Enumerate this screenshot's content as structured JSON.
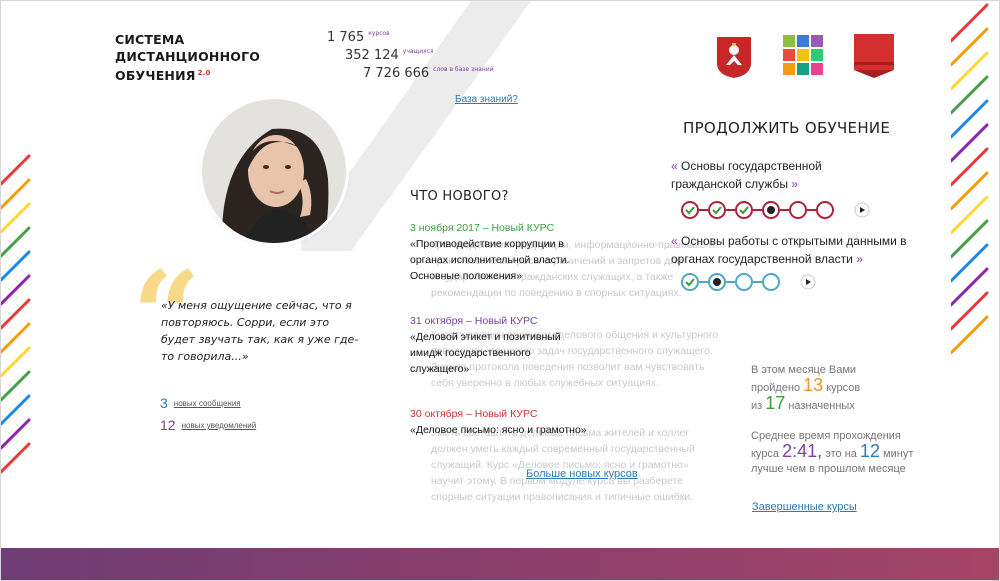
{
  "brand": {
    "line1": "СИСТЕМА",
    "line2": "ДИСТАНЦИОННОГО",
    "line3": "ОБУЧЕНИЯ",
    "version": "2.0"
  },
  "stats": [
    {
      "value": "1 765",
      "label": "курсов"
    },
    {
      "value": "352 124",
      "label": "учащихся"
    },
    {
      "value": "7 726 666",
      "label": "слов в базе знаний"
    }
  ],
  "knowledge_link": "База знаний?",
  "logos": [
    "moscow-coat-of-arms-icon",
    "mosaic-logo-icon",
    "red-banner-logo-icon"
  ],
  "quote": {
    "text": "«У меня ощущение сейчас, что я повторяюсь. Сорри, если это будет звучать так, как я уже где-то говорила...»"
  },
  "counters": [
    {
      "number": "3",
      "label": "новых сообщения",
      "color": "#2a7ab8"
    },
    {
      "number": "12",
      "label": "новых уведомлений",
      "color": "#7a3fa0"
    }
  ],
  "news": {
    "title": "ЧТО НОВОГО?",
    "items": [
      {
        "date": "3 ноября 2017 – Новый КУРС",
        "color": "#3a9e3a",
        "headline": "«Противодействие коррупции в органах исполнительной власти. Основные положения»"
      },
      {
        "date": "31 октября – Новый КУРС",
        "color": "#7a3fa0",
        "headline": "«Деловой этикет и позитивный имидж государственного служащего»"
      },
      {
        "date": "30 октября – Новый КУРС",
        "color": "#d32f2f",
        "headline": "«Деловое письмо: ясно и грамотно»"
      }
    ],
    "ghost_texts": [
      "противодействия коррупции, информационно-правовые и практические вопросы ограничений и запретов для государственных гражданских служащих, а также рекомендации по поведению в спорных ситуациях.",
      "Курс посвящен правилам делового общения и культурного поведения, решению задач государственного служащего. Знание протокола поведения позволит вам чувствовать себя уверенно в любых служебных ситуациях.",
      "Уметь составлять деловые письма жителей и коллег должен уметь каждый современный государственный служащий. Курс «Деловое письмо: ясно и грамотно» научит этому. В первом модуле курса вы разберете спорные ситуации правописания и типичные ошибки."
    ],
    "more_link": "Больше новых курсов"
  },
  "continue": {
    "title": "ПРОДОЛЖИТЬ ОБУЧЕНИЕ",
    "courses": [
      {
        "name": "Основы государственной гражданской службы",
        "color": "#b0223a",
        "steps": [
          "done",
          "done",
          "done",
          "current",
          "todo",
          "todo"
        ]
      },
      {
        "name": "Основы работы с открытыми данными в органах государственной власти",
        "color": "#4aaac0",
        "steps": [
          "done",
          "current",
          "todo",
          "todo"
        ]
      }
    ]
  },
  "summary": {
    "l1": "В этом месяце Вами",
    "l2a": "пройдено",
    "completed": "13",
    "l2b": "курсов",
    "l3a": "из",
    "assigned": "17",
    "l3b": "назначенных",
    "l4": "Среднее время прохождения",
    "l5a": "курса",
    "avg_time": "2:41,",
    "l5b": "это на",
    "faster": "12",
    "l5c": "минут",
    "l6": "лучше чем в прошлом месяце"
  },
  "done_link": "Завершенные курсы",
  "colors": {
    "green": "#3a9e3a",
    "orange": "#f0932b",
    "purple": "#7a3fa0",
    "blue": "#2a7ab8",
    "red": "#d32f2f",
    "footer": "#8a3e6c"
  }
}
